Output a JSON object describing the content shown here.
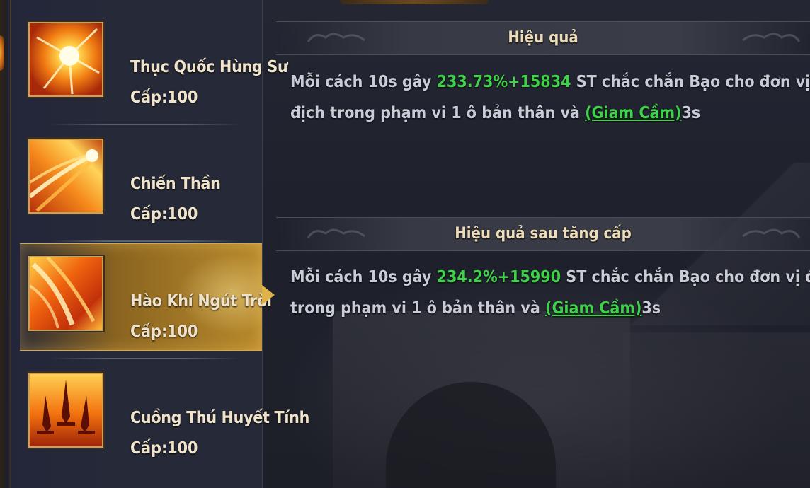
{
  "skills": [
    {
      "name": "Thục Quốc Hùng Sư",
      "level": "Cấp:100",
      "icon": "sunburst-fire-icon"
    },
    {
      "name": "Chiến Thần",
      "level": "Cấp:100",
      "icon": "fire-comet-icon"
    },
    {
      "name": "Hào Khí Ngút Trời",
      "level": "Cấp:100",
      "icon": "flame-wave-icon"
    },
    {
      "name": "Cuồng Thú Huyết Tính",
      "level": "Cấp:100",
      "icon": "burning-swords-icon"
    }
  ],
  "selected_index": 2,
  "effect": {
    "title": "Hiệu quả",
    "line1_prefix": "Mỗi cách 10s gây ",
    "line1_value": "233.73%+15834",
    "line1_suffix": " ST chắc chắn Bạo cho đơn vị",
    "line2_prefix": "địch trong phạm vi 1 ô bản thân và ",
    "line2_tag": "(Giam Cầm)",
    "line2_suffix": "3s"
  },
  "effect_upgrade": {
    "title": "Hiệu quả sau tăng cấp",
    "line1_prefix": "Mỗi cách 10s gây ",
    "line1_value": "234.2%+15990",
    "line1_suffix": " ST chắc chắn Bạo cho đơn vị địch",
    "line2_prefix": "trong phạm vi 1 ô bản thân và ",
    "line2_tag": "(Giam Cầm)",
    "line2_suffix": "3s"
  },
  "colors": {
    "highlight": "#3fd14a",
    "text": "#c9ccd6",
    "title": "#eddcb9",
    "selected": "#b98a2c"
  }
}
